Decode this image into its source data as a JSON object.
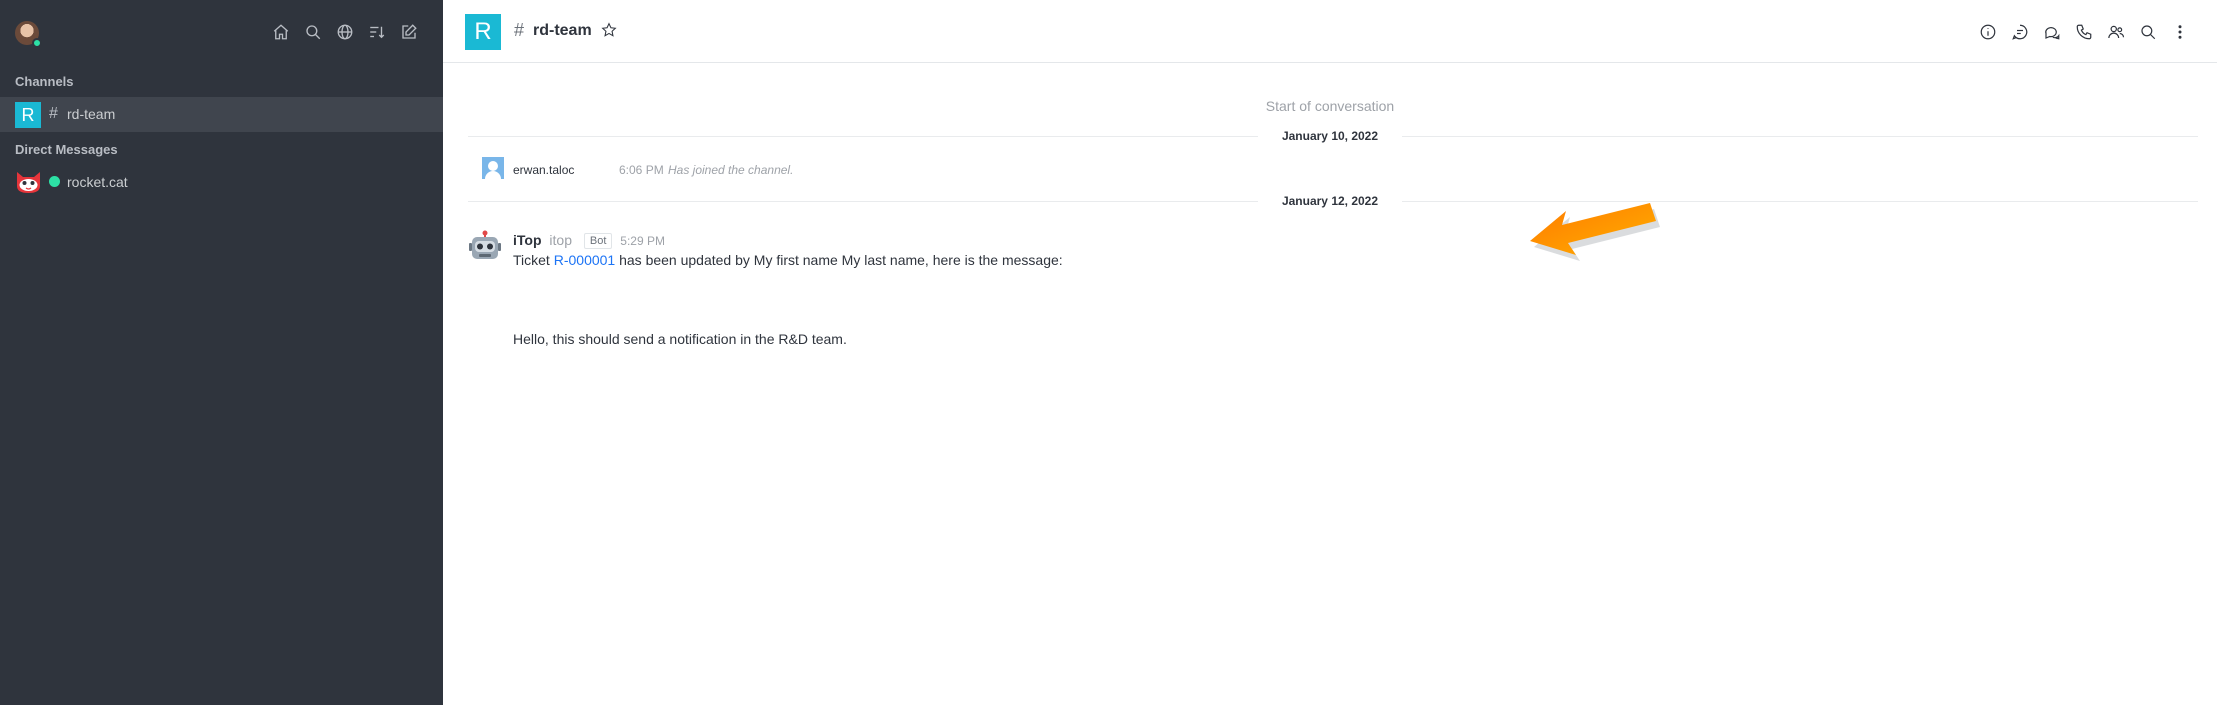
{
  "sidebar": {
    "sections": {
      "channels": "Channels",
      "direct_messages": "Direct Messages"
    },
    "icons": [
      "home-icon",
      "search-icon",
      "directory-icon",
      "sort-icon",
      "create-new-icon"
    ],
    "channels": [
      {
        "avatar_letter": "R",
        "name": "rd-team",
        "color": "#1ab9d4"
      }
    ],
    "direct_messages": [
      {
        "name": "rocket.cat",
        "status": "online"
      }
    ]
  },
  "room": {
    "avatar_letter": "R",
    "name": "rd-team",
    "header_icons": [
      "info-icon",
      "threads-icon",
      "discussion-icon",
      "call-icon",
      "members-icon",
      "search-icon",
      "kebab-menu-icon"
    ]
  },
  "conversation": {
    "start_label": "Start of conversation",
    "dates": [
      "January 10, 2022",
      "January 12, 2022"
    ],
    "system_message": {
      "user": "erwan.taloc",
      "time": "6:06 PM",
      "text": "Has joined the channel."
    },
    "message": {
      "author": "iTop",
      "username": "itop",
      "badge": "Bot",
      "time": "5:29 PM",
      "text_before_link": "Ticket ",
      "link_text": "R-000001",
      "text_after_link": " has been updated by My first name My last name, here is the message:",
      "body": "Hello, this should send a notification in the R&D team."
    }
  },
  "colors": {
    "sidebar_bg": "#2f343d",
    "accent": "#1ab9d4",
    "link": "#1d74f5",
    "online": "#2de0a5",
    "arrow": "#ff8a00"
  }
}
